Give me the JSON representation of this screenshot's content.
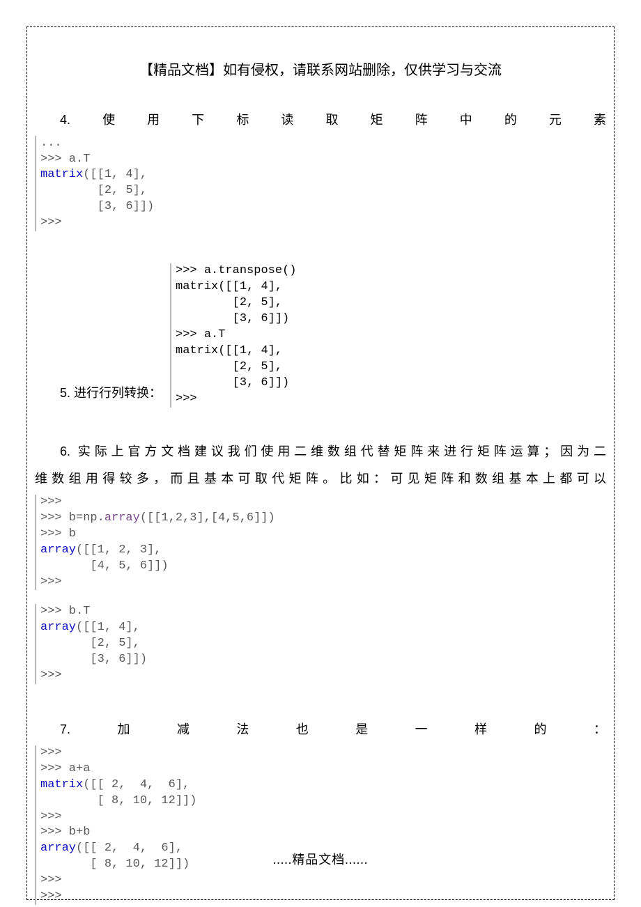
{
  "title": "【精品文档】如有侵权，请联系网站删除，仅供学习与交流",
  "section4": "4.使用下标读取矩阵中的元素",
  "code4": {
    "l1": "...",
    "l2": ">>> a.T",
    "l3a": "matrix",
    "l3b": "([[1, 4],",
    "l4": "        [2, 5],",
    "l5": "        [3, 6]])",
    "l6": ">>> "
  },
  "section5_text": "5. 进行行列转换：",
  "code5": {
    "l1a": ">>> a.",
    "l1b": "transpose",
    "l1c": "()",
    "l2a": "matrix",
    "l2b": "([[1, 4],",
    "l3": "        [2, 5],",
    "l4": "        [3, 6]])",
    "l5": ">>> a.T",
    "l6a": "matrix",
    "l6b": "([[1, 4],",
    "l7": "        [2, 5],",
    "l8": "        [3, 6]])",
    "l9": ">>> "
  },
  "section6_a": "6. 实际上官方文档建议我们使用二维数组代替矩阵来进行矩阵运算；因为二",
  "section6_b": "维数组用得较多，而且基本可取代矩阵。比如：可见矩阵和数组基本上都可以",
  "code6a": {
    "l1": ">>> ",
    "l2a": ">>> b=np.",
    "l2b": "array",
    "l2c": "([[1,2,3],[4,5,6]])",
    "l3": ">>> b",
    "l4a": "array",
    "l4b": "([[1, 2, 3],",
    "l5": "       [4, 5, 6]])",
    "l6": ">>> "
  },
  "code6b": {
    "l1": ">>> b.T",
    "l2a": "array",
    "l2b": "([[1, 4],",
    "l3": "       [2, 5],",
    "l4": "       [3, 6]])",
    "l5": ">>> "
  },
  "section7": "7.加减法也是一样的：",
  "code7": {
    "l1": ">>> ",
    "l2": ">>> a+a",
    "l3a": "matrix",
    "l3b": "([[ 2,  4,  6],",
    "l4": "        [ 8, 10, 12]])",
    "l5": ">>> ",
    "l6": ">>> b+b",
    "l7a": "array",
    "l7b": "([[ 2,  4,  6],",
    "l8": "       [ 8, 10, 12]])",
    "l9": ">>> ",
    "l10": ">>> "
  },
  "footer": ".....精品文档......"
}
